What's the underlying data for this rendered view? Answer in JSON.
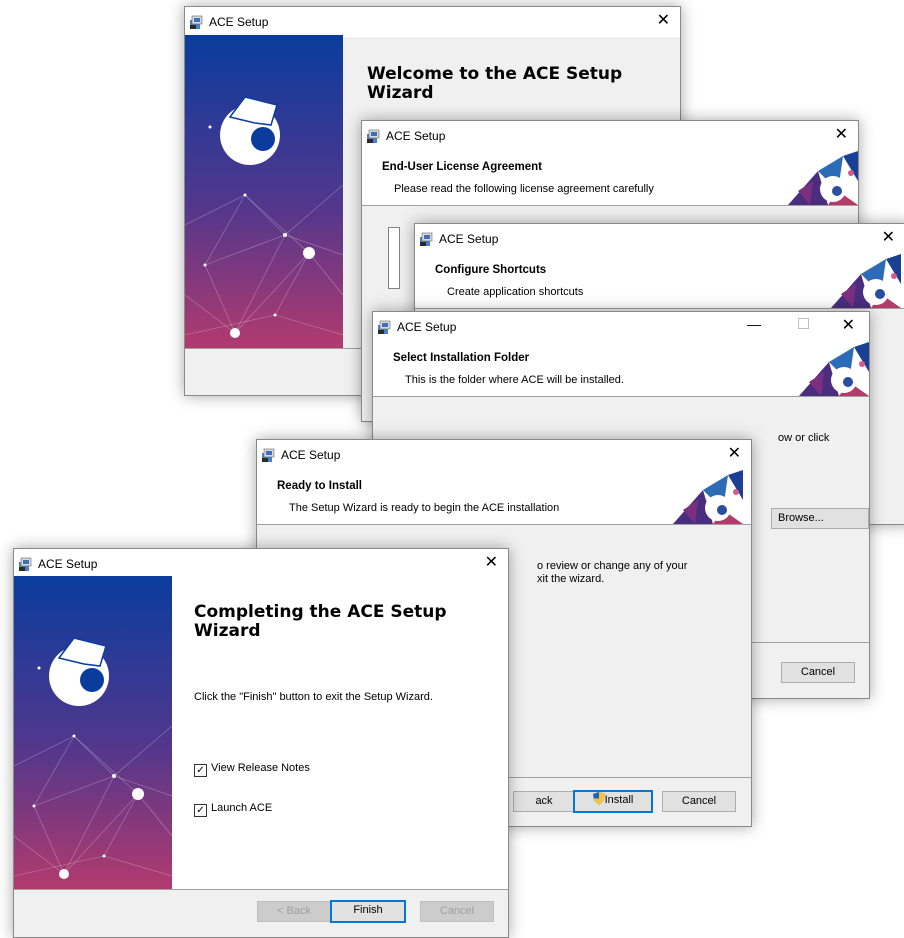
{
  "common": {
    "title": "ACE Setup",
    "close_glyph": "✕"
  },
  "welcome": {
    "heading": "Welcome to the ACE Setup Wizard"
  },
  "eula": {
    "header_title": "End-User License Agreement",
    "header_sub": "Please read the following license agreement carefully"
  },
  "shortcuts": {
    "header_title": "Configure Shortcuts",
    "header_sub": "Create application shortcuts"
  },
  "folder": {
    "header_title": "Select Installation Folder",
    "header_sub": "This is the folder where ACE will be installed.",
    "partial_text": "ow or click",
    "browse_label": "Browse...",
    "cancel_label": "Cancel"
  },
  "ready": {
    "header_title": "Ready to Install",
    "header_sub": "The Setup Wizard is ready to begin the ACE installation",
    "body_line1": "o review or change any of your",
    "body_line2": "xit the wizard.",
    "back_label": "ack",
    "install_label": "Install",
    "cancel_label": "Cancel"
  },
  "complete": {
    "heading": "Completing the ACE Setup Wizard",
    "body": "Click the \"Finish\" button to exit the Setup Wizard.",
    "check1_label": "View Release Notes",
    "check1_checked": true,
    "check2_label": "Launch ACE",
    "check2_checked": true,
    "back_label": "< Back",
    "finish_label": "Finish",
    "cancel_label": "Cancel"
  },
  "colors": {
    "panel_top": "#0a3c9e",
    "panel_mid": "#53378c",
    "panel_bottom": "#b23a6e",
    "accent": "#0078d7"
  }
}
